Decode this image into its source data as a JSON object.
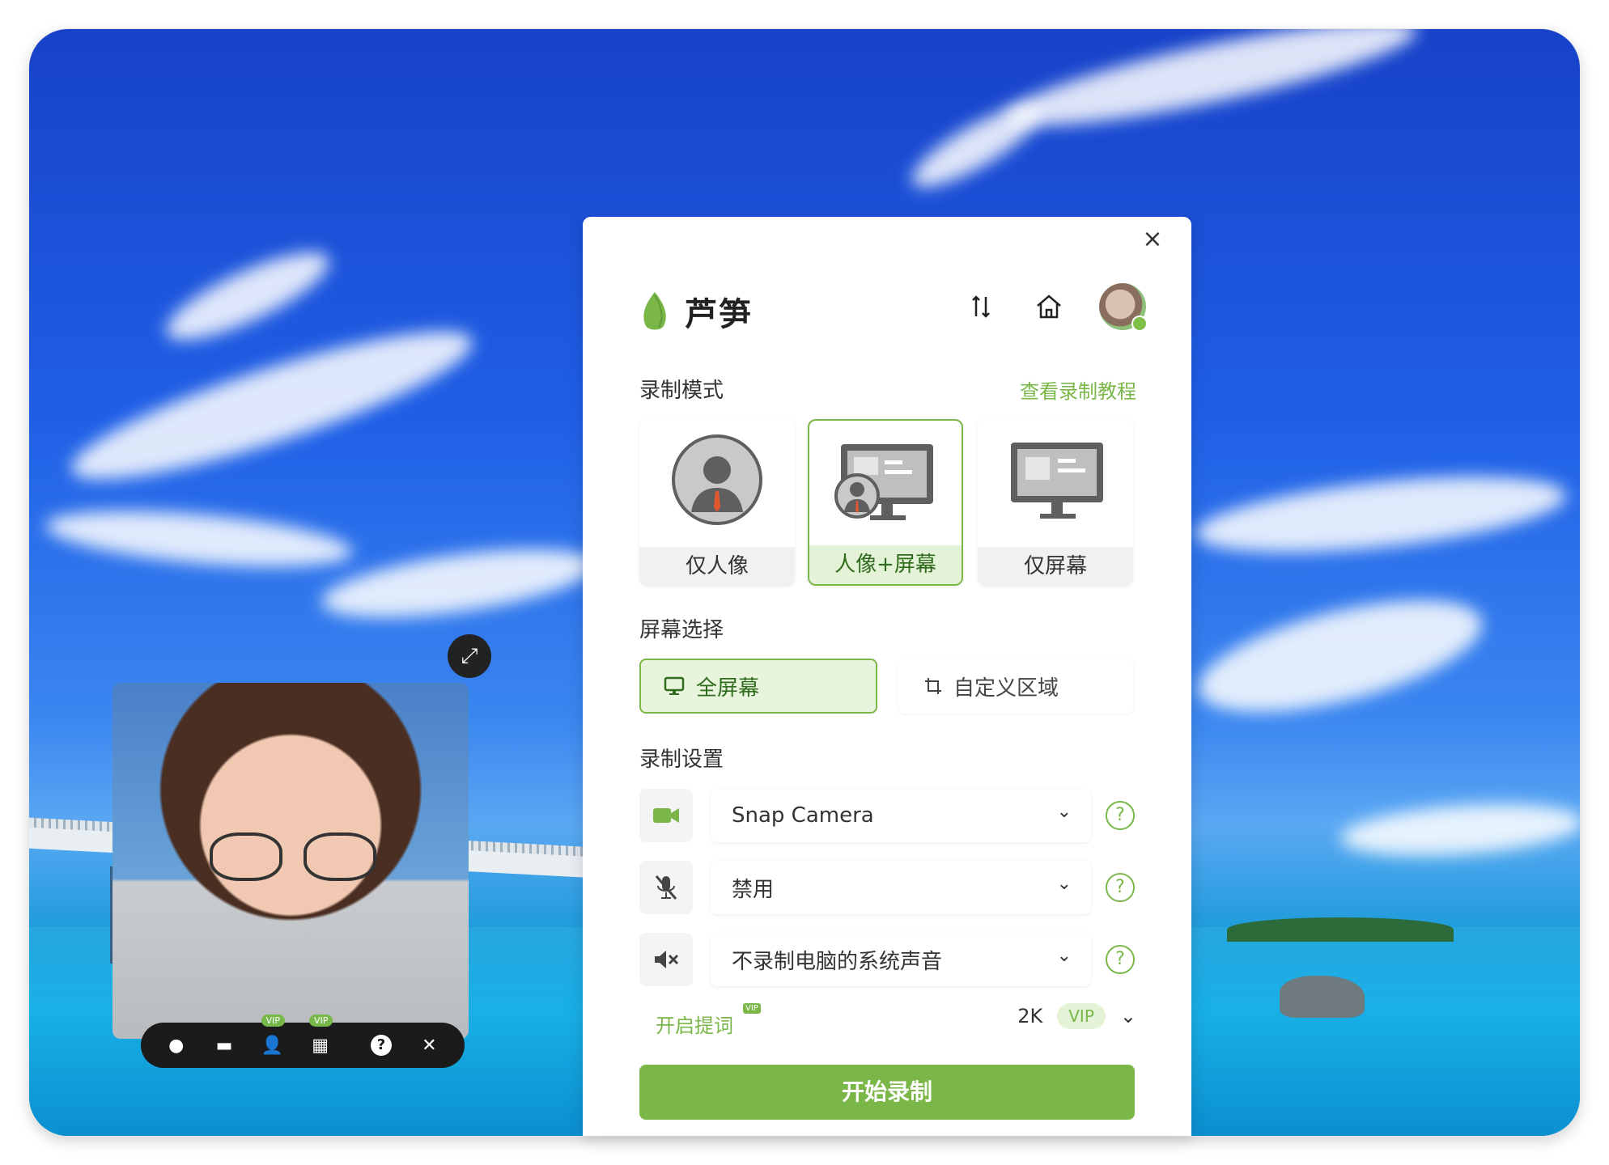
{
  "dialog": {
    "brand": "芦笋",
    "close_glyph": "×",
    "record_mode": {
      "title": "录制模式",
      "tutorial_link": "查看录制教程",
      "options": [
        {
          "label": "仅人像",
          "icon": "person-icon",
          "selected": false
        },
        {
          "label": "人像+屏幕",
          "icon": "person-screen-icon",
          "selected": true
        },
        {
          "label": "仅屏幕",
          "icon": "screen-icon",
          "selected": false
        }
      ]
    },
    "screen_select": {
      "title": "屏幕选择",
      "full": "全屏幕",
      "custom": "自定义区域"
    },
    "settings": {
      "title": "录制设置",
      "camera": "Snap Camera",
      "microphone": "禁用",
      "system_audio": "不录制电脑的系统声音",
      "help_glyph": "?",
      "chevron_glyph": "⌄"
    },
    "teleprompter": "开启提词",
    "teleprompter_badge": "VIP",
    "quality": "2K",
    "quality_vip": "VIP",
    "start": "开始录制"
  },
  "webcam_toolbar": {
    "vip_1": "VIP",
    "vip_2": "VIP",
    "help_glyph": "?",
    "close_glyph": "✕"
  },
  "colors": {
    "accent": "#7ab648",
    "accent_light": "#e4f3d7",
    "text": "#333333"
  }
}
